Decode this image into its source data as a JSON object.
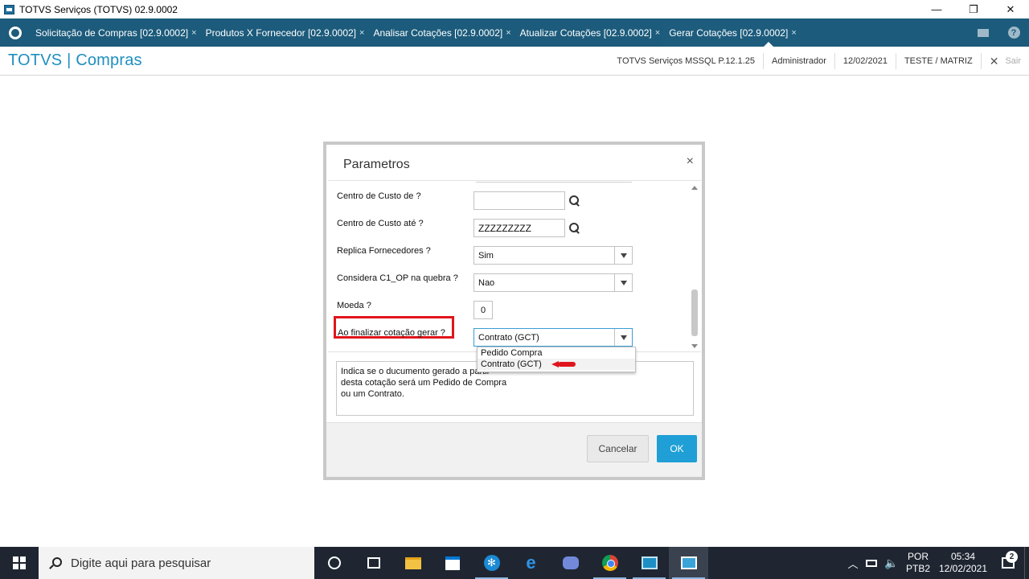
{
  "window": {
    "title": "TOTVS Serviços (TOTVS) 02.9.0002",
    "minimize": "—",
    "maximize": "❐",
    "close": "✕"
  },
  "tabs": [
    {
      "label": "Solicitação de Compras [02.9.0002]",
      "close": "×"
    },
    {
      "label": "Produtos X Fornecedor [02.9.0002]",
      "close": "×"
    },
    {
      "label": "Analisar Cotações [02.9.0002]",
      "close": "×"
    },
    {
      "label": "Atualizar Cotações [02.9.0002]",
      "close": "×"
    },
    {
      "label": "Gerar Cotações [02.9.0002]",
      "close": "×"
    }
  ],
  "header": {
    "brand": "TOTVS | Compras",
    "environment": "TOTVS Serviços MSSQL P.12.1.25",
    "user": "Administrador",
    "date": "12/02/2021",
    "company": "TESTE / MATRIZ",
    "exit_label": "Sair"
  },
  "dialog": {
    "title": "Parametros",
    "close": "×",
    "params": {
      "centro_custo_de": {
        "label": "Centro de Custo de ?",
        "value": ""
      },
      "centro_custo_ate": {
        "label": "Centro de Custo até ?",
        "value": "ZZZZZZZZZ"
      },
      "replica_fornecedores": {
        "label": "Replica Fornecedores ?",
        "value": "Sim"
      },
      "considera_c1_op": {
        "label": "Considera C1_OP na quebra ?",
        "value": "Nao"
      },
      "moeda": {
        "label": "Moeda ?",
        "value": "0"
      },
      "ao_finalizar": {
        "label": "Ao finalizar cotação gerar ?",
        "value": "Contrato (GCT)"
      }
    },
    "dropdown_options": [
      "Pedido Compra",
      "Contrato (GCT)"
    ],
    "help_lines": [
      "Indica se o ducumento gerado a partir",
      "desta cotação será um Pedido de Compra",
      "ou um Contrato."
    ],
    "cancel_label": "Cancelar",
    "ok_label": "OK"
  },
  "taskbar": {
    "search_placeholder": "Digite aqui para pesquisar",
    "lang_line1": "POR",
    "lang_line2": "PTB2",
    "time": "05:34",
    "date": "12/02/2021",
    "notification_count": "2"
  },
  "colors": {
    "tabs_bg": "#1c5b7b",
    "brand": "#1f8fbf",
    "ok_button": "#1f9fd6",
    "highlight": "#e0151b",
    "taskbar": "#1f2632"
  }
}
